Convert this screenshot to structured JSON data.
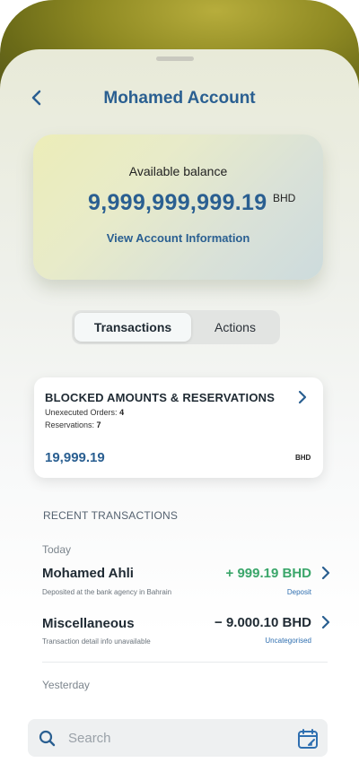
{
  "header": {
    "title": "Mohamed Account"
  },
  "balance": {
    "label": "Available balance",
    "amount": "9,999,999,999.19",
    "currency": "BHD",
    "link": "View Account Information"
  },
  "tabs": [
    {
      "label": "Transactions",
      "active": true
    },
    {
      "label": "Actions",
      "active": false
    }
  ],
  "blocked": {
    "title": "BLOCKED AMOUNTS & RESERVATIONS",
    "unexecuted_label": "Unexecuted Orders:",
    "unexecuted_value": "4",
    "reservations_label": "Reservations:",
    "reservations_value": "7",
    "amount": "19,999.19",
    "currency": "BHD"
  },
  "recent": {
    "heading": "RECENT TRANSACTIONS",
    "groups": [
      {
        "day": "Today",
        "items": [
          {
            "name": "Mohamed Ahli",
            "subtitle": "Deposited at the bank agency in Bahrain",
            "amount": "+ 999.19 BHD",
            "category": "Deposit",
            "color": "#3aa66a"
          },
          {
            "name": "Miscellaneous",
            "subtitle": "Transaction detail info unavailable",
            "amount": "− 9.000.10 BHD",
            "category": "Uncategorised",
            "color": "#1f2a33"
          }
        ]
      },
      {
        "day": "Yesterday",
        "items": []
      }
    ]
  },
  "search": {
    "placeholder": "Search"
  },
  "icons": {
    "back": "chevron-left-icon",
    "chevron": "chevron-right-icon",
    "search": "search-icon",
    "calendar": "calendar-icon"
  },
  "colors": {
    "brand_blue": "#2a5f91",
    "positive": "#3aa66a",
    "header_band": "#8f8a23"
  }
}
